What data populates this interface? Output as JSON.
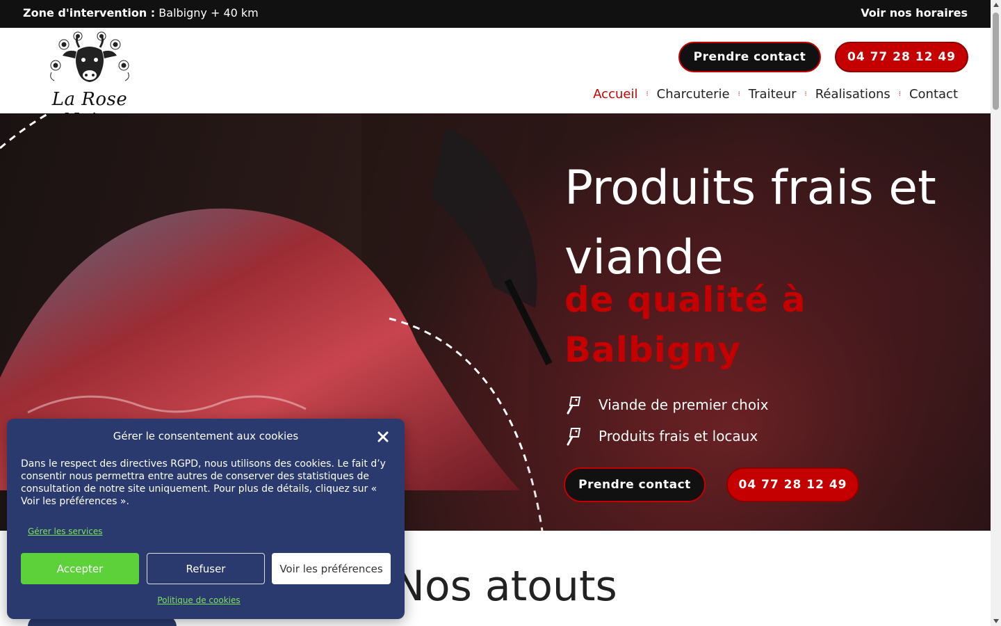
{
  "topbar": {
    "zone_label": "Zone d'intervention :",
    "zone_value": "Balbigny + 40 km",
    "hours_link": "Voir nos horaires"
  },
  "header": {
    "logo_text": "La Rose Noire",
    "contact_button": "Prendre contact",
    "phone_button": "04 77 28 12 49"
  },
  "nav": {
    "items": [
      {
        "label": "Accueil",
        "active": true
      },
      {
        "label": "Charcuterie",
        "active": false
      },
      {
        "label": "Traiteur",
        "active": false
      },
      {
        "label": "Réalisations",
        "active": false
      },
      {
        "label": "Contact",
        "active": false
      }
    ]
  },
  "hero": {
    "title": "Produits frais et viande",
    "subtitle": "de qualité à Balbigny",
    "features": [
      {
        "icon": "cleaver-icon",
        "label": "Viande de premier choix"
      },
      {
        "icon": "cleaver-icon",
        "label": "Produits frais et locaux"
      }
    ],
    "contact_button": "Prendre contact",
    "phone_button": "04 77 28 12 49"
  },
  "section": {
    "heading": "Nos atouts"
  },
  "cookie_modal": {
    "title": "Gérer le consentement aux cookies",
    "text": "Dans le respect des directives RGPD, nous utilisons des cookies. Le fait d’y consentir nous permettra entre autres de conserver des statistiques de consultation de notre site uniquement. Pour plus de détails, cliquez sur « Voir les préférences ».",
    "manage_link": "Gérer les services",
    "accept_button": "Accepter",
    "refuse_button": "Refuser",
    "preferences_button": "Voir les préférences",
    "policy_link": "Politique de cookies"
  },
  "colors": {
    "accent_red": "#c40000",
    "dark": "#111111",
    "cookie_bg": "#2a3a6e",
    "cookie_green": "#5cd13a"
  }
}
